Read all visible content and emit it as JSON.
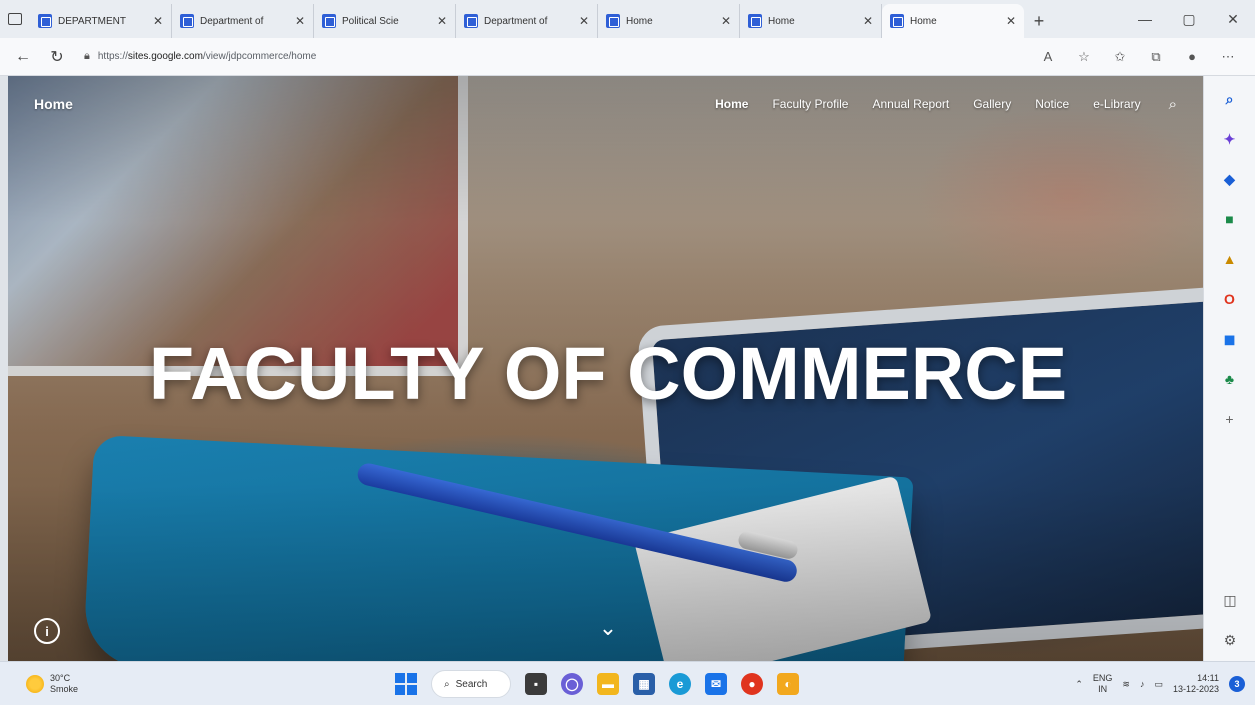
{
  "browser": {
    "tabs": [
      {
        "title": "DEPARTMENT",
        "active": false
      },
      {
        "title": "Department of",
        "active": false
      },
      {
        "title": "Political Scie",
        "active": false
      },
      {
        "title": "Department of",
        "active": false
      },
      {
        "title": "Home",
        "active": false
      },
      {
        "title": "Home",
        "active": false
      },
      {
        "title": "Home",
        "active": true
      }
    ],
    "url": {
      "prefix": "https://",
      "host": "sites.google.com",
      "path": "/view/jdpcommerce/home"
    }
  },
  "site": {
    "title": "Home",
    "nav": [
      "Home",
      "Faculty Profile",
      "Annual Report",
      "Gallery",
      "Notice",
      "e-Library"
    ],
    "hero_title": "FACULTY OF COMMERCE"
  },
  "taskbar": {
    "weather_temp": "30°C",
    "weather_desc": "Smoke",
    "search_label": "Search",
    "lang_top": "ENG",
    "lang_bottom": "IN",
    "time": "14:11",
    "date": "13-12-2023",
    "notification_count": "3"
  },
  "colors": {
    "accent": "#1a73e8",
    "tab_favicon": "#2f5fd6"
  }
}
